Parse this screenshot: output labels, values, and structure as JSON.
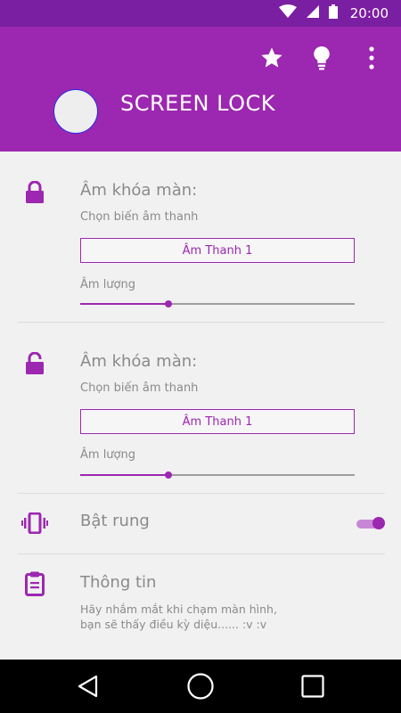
{
  "status_bar": {
    "time": "20:00",
    "icons": [
      "wifi-icon",
      "cell-signal-icon",
      "battery-icon"
    ]
  },
  "app_bar": {
    "title": "SCREEN LOCK",
    "actions": [
      "star-icon",
      "lightbulb-icon",
      "more-vert-icon"
    ],
    "color": "#9c27b0"
  },
  "sections": [
    {
      "icon": "lock-closed-icon",
      "title": "Âm khóa màn:",
      "subtitle": "Chọn biến âm thanh",
      "sound_button": "Âm Thanh 1",
      "volume_label": "Âm lượng",
      "volume": 0.32
    },
    {
      "icon": "lock-open-icon",
      "title": "Âm khóa màn:",
      "subtitle": "Chọn biến âm thanh",
      "sound_button": "Âm Thanh 1",
      "volume_label": "Âm lượng",
      "volume": 0.32
    }
  ],
  "vibrate": {
    "icon": "vibration-icon",
    "label": "Bật rung",
    "enabled": true
  },
  "info": {
    "icon": "clipboard-icon",
    "title": "Thông tin",
    "text_line1": "Hãy nhắm mắt khi chạm màn hình,",
    "text_line2": "bạn sẽ thấy điều kỳ diệu...... :v :v"
  },
  "nav_bar": {
    "buttons": [
      "back-icon",
      "home-icon",
      "recents-icon"
    ]
  },
  "colors": {
    "accent": "#9c27b0",
    "status_bar": "#7b1fa2",
    "background": "#f1f1f1"
  }
}
